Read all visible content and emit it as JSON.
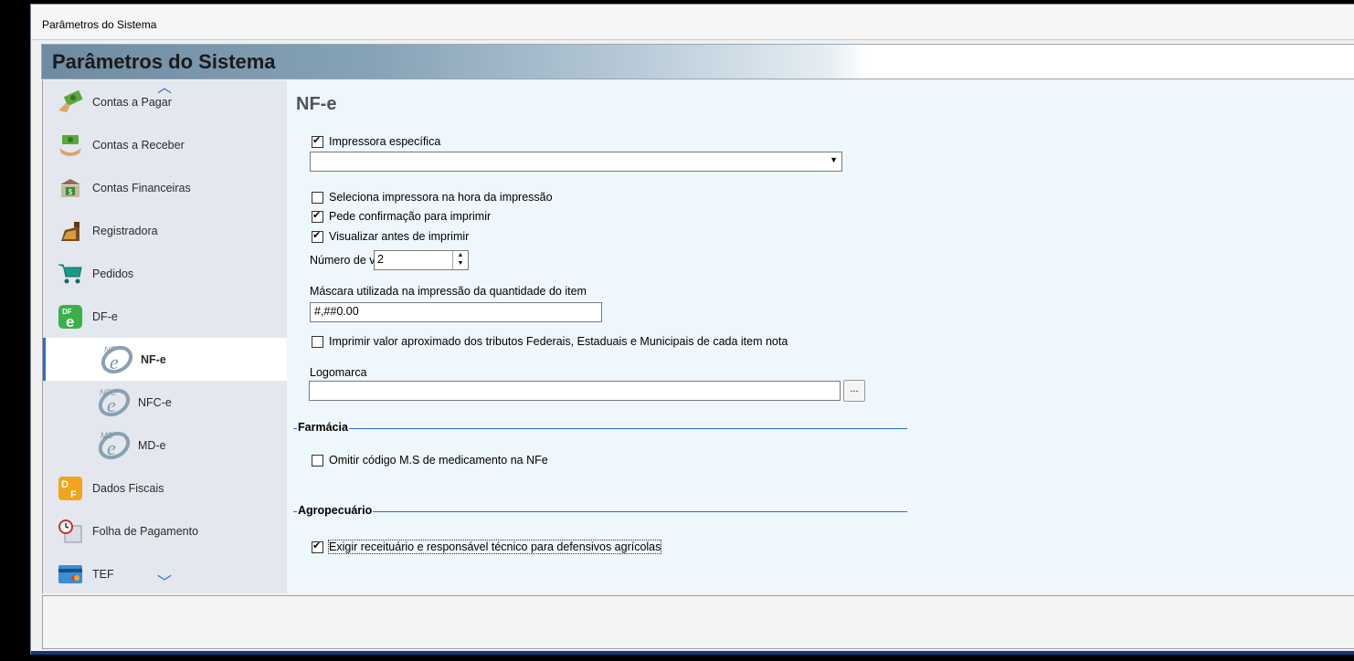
{
  "window": {
    "title": "Parâmetros do Sistema"
  },
  "header": {
    "title": "Parâmetros do Sistema"
  },
  "sidebar": {
    "items": [
      {
        "label": "Contas a Pagar",
        "icon": "money-hand-icon"
      },
      {
        "label": "Contas a Receber",
        "icon": "money-receive-icon"
      },
      {
        "label": "Contas Financeiras",
        "icon": "bank-icon"
      },
      {
        "label": "Registradora",
        "icon": "cash-register-icon"
      },
      {
        "label": "Pedidos",
        "icon": "cart-icon"
      },
      {
        "label": "DF-e",
        "icon": "dfe-icon"
      },
      {
        "label": "NF-e",
        "icon": "nfe-icon",
        "active": true
      },
      {
        "label": "NFC-e",
        "icon": "nfce-icon"
      },
      {
        "label": "MD-e",
        "icon": "mde-icon"
      },
      {
        "label": "Dados Fiscais",
        "icon": "dados-fiscais-icon"
      },
      {
        "label": "Folha de Pagamento",
        "icon": "clock-calendar-icon"
      },
      {
        "label": "TEF",
        "icon": "credit-card-icon"
      }
    ]
  },
  "content": {
    "title": "NF-e",
    "impressora_especifica": {
      "label": "Impressora específica",
      "checked": true
    },
    "printer_select": {
      "value": ""
    },
    "seleciona_impressora": {
      "label": "Seleciona impressora na hora da impressão",
      "checked": false
    },
    "pede_confirmacao": {
      "label": "Pede confirmação para imprimir",
      "checked": true
    },
    "visualizar": {
      "label": "Visualizar antes de imprimir",
      "checked": true
    },
    "numero_vias": {
      "label": "Número de vias",
      "value": "2"
    },
    "mascara": {
      "label": "Máscara utilizada na impressão da quantidade do item",
      "value": "#,##0.00"
    },
    "imprimir_tributos": {
      "label": "Imprimir valor aproximado dos tributos Federais, Estaduais e Municipais de cada item nota",
      "checked": false
    },
    "logomarca": {
      "label": "Logomarca",
      "value": "",
      "browse_label": "..."
    },
    "farmacia": {
      "title": "Farmácia",
      "omitir": {
        "label": "Omitir código M.S de medicamento na NFe",
        "checked": false
      }
    },
    "agropecuario": {
      "title": "Agropecuário",
      "exigir": {
        "label": "Exigir receituário e responsável técnico para defensivos agrícolas",
        "checked": true
      }
    }
  },
  "colors": {
    "accent": "#2a6fc9",
    "content_bg": "#eef7fb",
    "sidebar_bg": "#e4e8ee"
  }
}
